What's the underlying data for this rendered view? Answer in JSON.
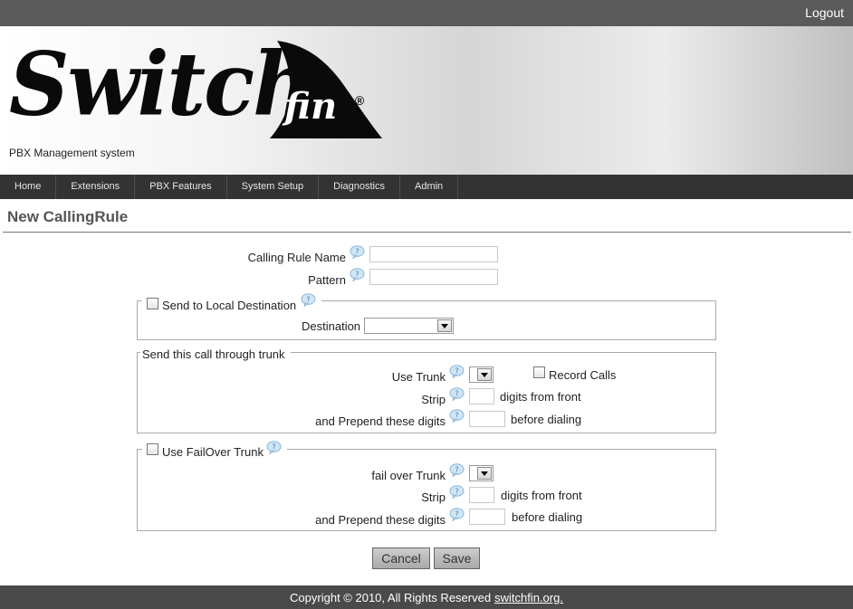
{
  "header": {
    "logout_label": "Logout"
  },
  "brand": {
    "logo_word": "Switch",
    "logo_fin": "fin",
    "registered": "®",
    "subtitle": "PBX Management system"
  },
  "nav": {
    "items": [
      {
        "label": "Home"
      },
      {
        "label": "Extensions"
      },
      {
        "label": "PBX Features"
      },
      {
        "label": "System Setup"
      },
      {
        "label": "Diagnostics"
      },
      {
        "label": "Admin"
      }
    ]
  },
  "page": {
    "title": "New CallingRule"
  },
  "form": {
    "calling_rule_name": {
      "label": "Calling Rule Name",
      "value": ""
    },
    "pattern": {
      "label": "Pattern",
      "value": ""
    },
    "local_dest": {
      "checkbox_label": "Send to Local Destination",
      "destination_label": "Destination",
      "destination_value": ""
    },
    "trunk": {
      "legend": "Send this call through trunk",
      "use_trunk_label": "Use Trunk",
      "use_trunk_value": "",
      "record_calls_label": "Record Calls",
      "strip_label": "Strip",
      "strip_suffix": "digits from front",
      "prepend_label": "and Prepend these digits",
      "prepend_suffix": "before dialing"
    },
    "failover": {
      "checkbox_label": "Use FailOver Trunk",
      "trunk_label": "fail over Trunk",
      "trunk_value": "",
      "strip_label": "Strip",
      "strip_suffix": "digits from front",
      "prepend_label": "and Prepend these digits",
      "prepend_suffix": "before dialing"
    },
    "cancel_label": "Cancel",
    "save_label": "Save"
  },
  "footer": {
    "copyright": "Copyright © 2010, All Rights Reserved",
    "link": "switchfin.org."
  },
  "colors": {
    "topbar": "#5a5a5a",
    "navbar": "#333333",
    "footer": "#4a4a4a",
    "title": "#555555"
  },
  "icons": {
    "help": "help-bubble-icon",
    "dropdown": "chevron-down-icon"
  }
}
